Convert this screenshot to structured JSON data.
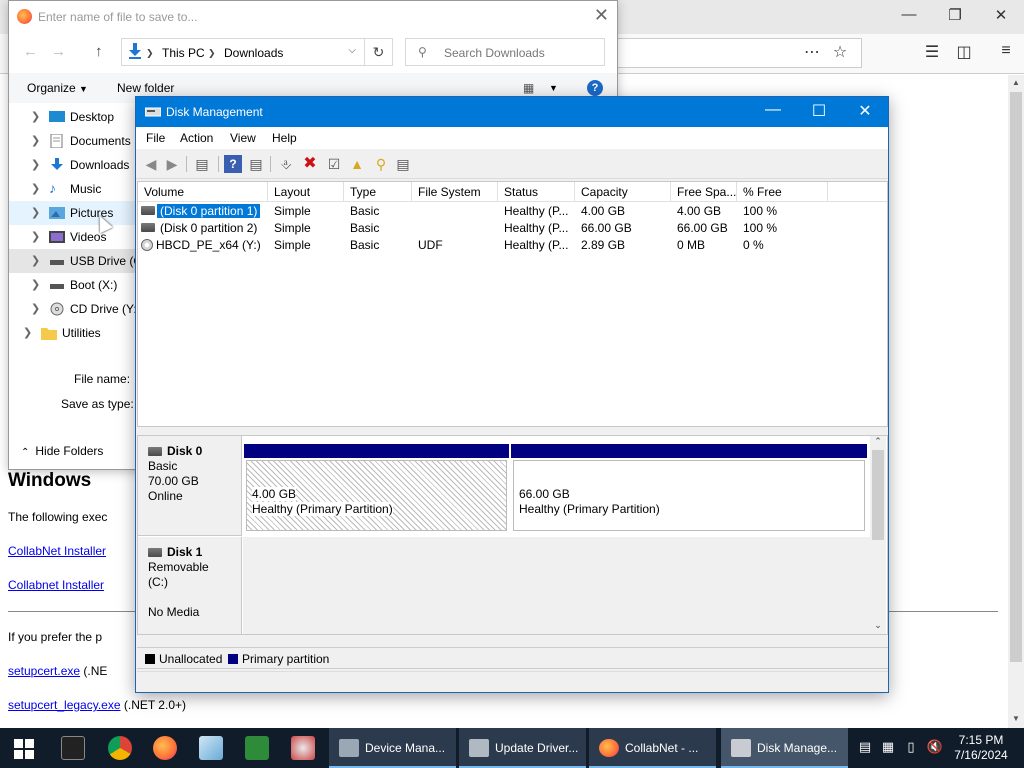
{
  "browser": {
    "page": {
      "heading": "Windows",
      "line1": "The following exec",
      "link1": "CollabNet Installer",
      "link2": "Collabnet Installer",
      "line2": "If you prefer the p",
      "link3": "setupcert.exe",
      "link3_suffix": "(.NE",
      "link4": "setupcert_legacy.exe",
      "link4_suffix": "(.NET 2.0+)"
    }
  },
  "save_dialog": {
    "title": "Enter name of file to save to...",
    "breadcrumb": [
      "This PC",
      "Downloads"
    ],
    "search_placeholder": "Search Downloads",
    "organize_label": "Organize",
    "new_folder_label": "New folder",
    "help_label": "?",
    "tree": [
      {
        "label": "Desktop",
        "icon": "desktop-icon"
      },
      {
        "label": "Documents",
        "icon": "documents-icon"
      },
      {
        "label": "Downloads",
        "icon": "downloads-icon"
      },
      {
        "label": "Music",
        "icon": "music-icon"
      },
      {
        "label": "Pictures",
        "icon": "pictures-icon"
      },
      {
        "label": "Videos",
        "icon": "videos-icon"
      },
      {
        "label": "USB Drive (C",
        "icon": "usb-drive-icon"
      },
      {
        "label": "Boot (X:)",
        "icon": "drive-icon"
      },
      {
        "label": "CD Drive (Y:)",
        "icon": "cd-drive-icon"
      },
      {
        "label": "Utilities",
        "icon": "folder-icon"
      }
    ],
    "file_name_label": "File name:",
    "save_as_type_label": "Save as type:",
    "hide_folders_label": "Hide Folders"
  },
  "disk_mgmt": {
    "title": "Disk Management",
    "menu": [
      "File",
      "Action",
      "View",
      "Help"
    ],
    "columns": [
      "Volume",
      "Layout",
      "Type",
      "File System",
      "Status",
      "Capacity",
      "Free Spa...",
      "% Free"
    ],
    "volumes": [
      {
        "volume": "(Disk 0 partition 1)",
        "layout": "Simple",
        "type": "Basic",
        "fs": "",
        "status": "Healthy (P...",
        "capacity": "4.00 GB",
        "free": "4.00 GB",
        "pct": "100 %"
      },
      {
        "volume": "(Disk 0 partition 2)",
        "layout": "Simple",
        "type": "Basic",
        "fs": "",
        "status": "Healthy (P...",
        "capacity": "66.00 GB",
        "free": "66.00 GB",
        "pct": "100 %"
      },
      {
        "volume": "HBCD_PE_x64 (Y:)",
        "layout": "Simple",
        "type": "Basic",
        "fs": "UDF",
        "status": "Healthy (P...",
        "capacity": "2.89 GB",
        "free": "0 MB",
        "pct": "0 %"
      }
    ],
    "disks": [
      {
        "name": "Disk 0",
        "type": "Basic",
        "size": "70.00 GB",
        "state": "Online",
        "partitions": [
          {
            "size": "4.00 GB",
            "status": "Healthy (Primary Partition)"
          },
          {
            "size": "66.00 GB",
            "status": "Healthy (Primary Partition)"
          }
        ]
      },
      {
        "name": "Disk 1",
        "type": "Removable (C:)",
        "state": "No Media"
      }
    ],
    "legend": [
      {
        "label": "Unallocated",
        "color": "#000000"
      },
      {
        "label": "Primary partition",
        "color": "#000080"
      }
    ]
  },
  "taskbar": {
    "tasks": [
      {
        "label": "Device Mana..."
      },
      {
        "label": "Update Driver..."
      },
      {
        "label": "CollabNet - ..."
      },
      {
        "label": "Disk Manage..."
      }
    ],
    "time": "7:15 PM",
    "date": "7/16/2024"
  },
  "colors": {
    "accent": "#0078d7",
    "primary_partition": "#000080",
    "taskbar": "#101c2a"
  }
}
